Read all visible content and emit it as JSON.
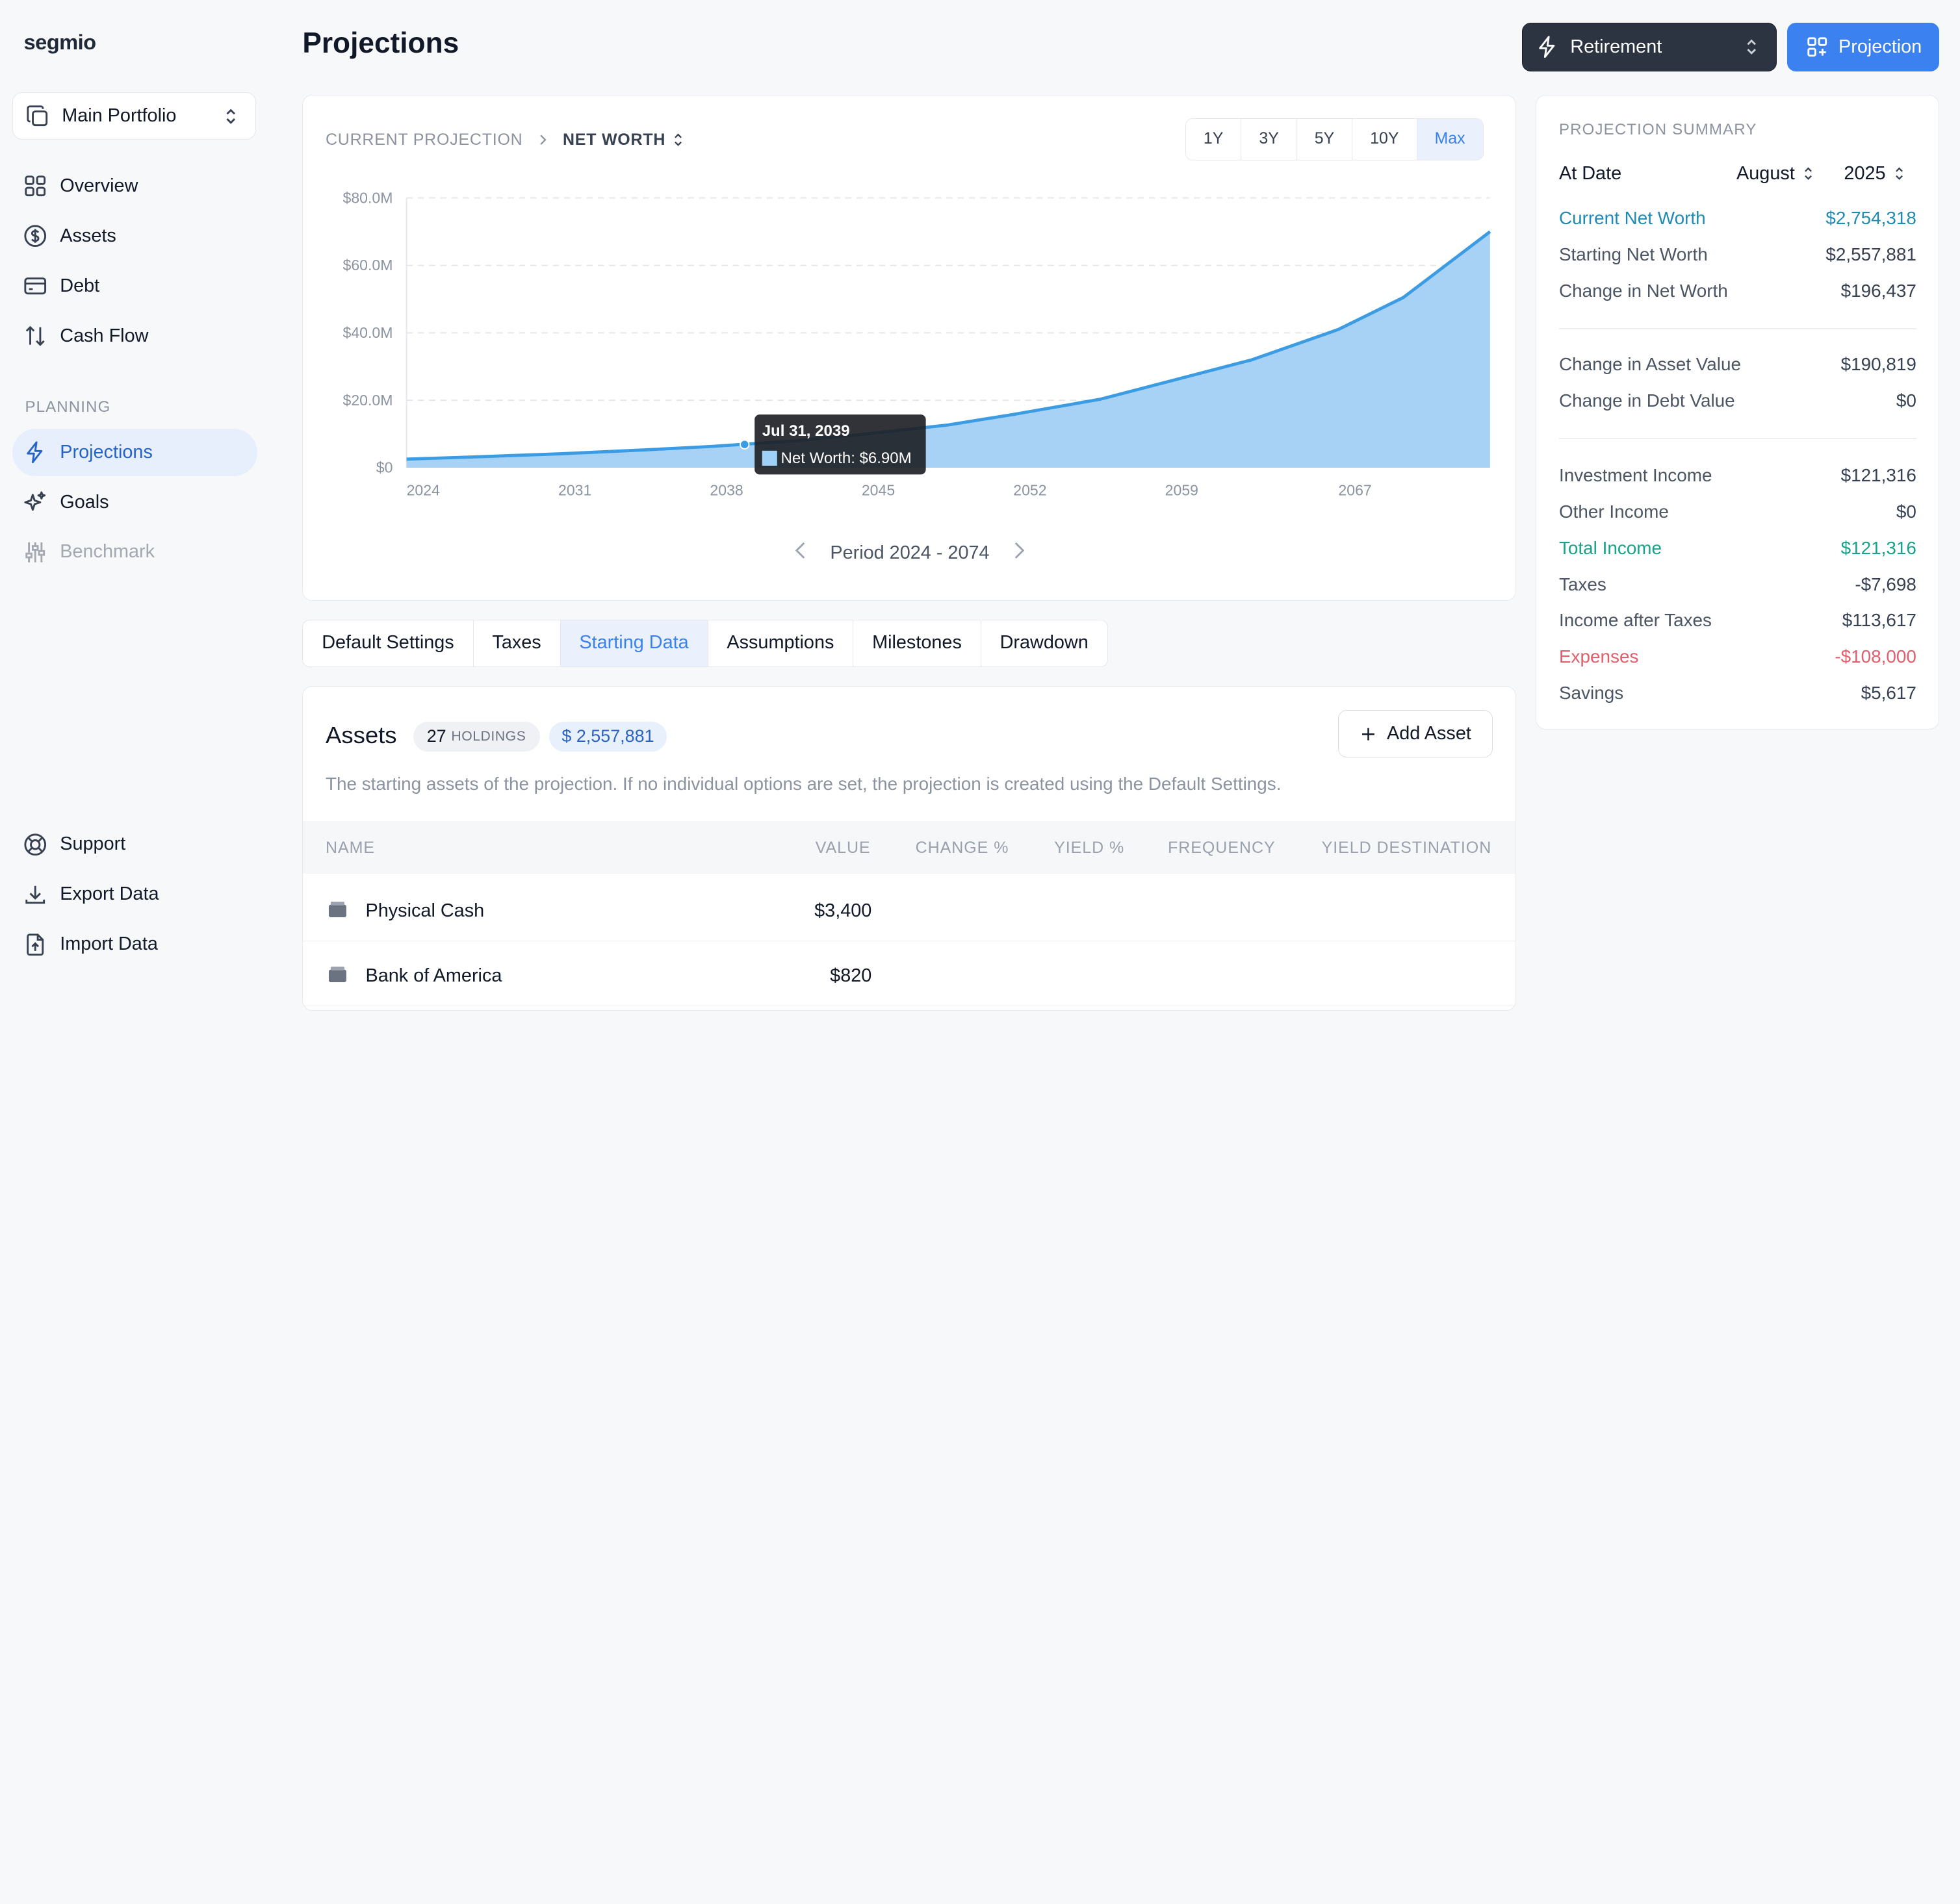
{
  "app": {
    "logo": "segmio"
  },
  "sidebar": {
    "portfolio": "Main Portfolio",
    "items": [
      {
        "label": "Overview",
        "icon": "grid-icon"
      },
      {
        "label": "Assets",
        "icon": "dollar-circle-icon"
      },
      {
        "label": "Debt",
        "icon": "credit-card-icon"
      },
      {
        "label": "Cash Flow",
        "icon": "arrows-up-down-icon"
      }
    ],
    "planning_label": "PLANNING",
    "planning_items": [
      {
        "label": "Projections",
        "icon": "bolt-icon"
      },
      {
        "label": "Goals",
        "icon": "sparkles-icon"
      },
      {
        "label": "Benchmark",
        "icon": "sliders-icon"
      }
    ],
    "footer_items": [
      {
        "label": "Support",
        "icon": "lifebuoy-icon"
      },
      {
        "label": "Export Data",
        "icon": "download-icon"
      },
      {
        "label": "Import Data",
        "icon": "file-upload-icon"
      }
    ]
  },
  "header": {
    "title": "Projections",
    "scenario": "Retirement",
    "projection_button": "Projection"
  },
  "chart_card": {
    "breadcrumb_parent": "CURRENT PROJECTION",
    "breadcrumb_current": "NET WORTH",
    "ranges": [
      "1Y",
      "3Y",
      "5Y",
      "10Y",
      "Max"
    ],
    "active_range": "Max",
    "period_label": "Period 2024 - 2074",
    "tooltip": {
      "date": "Jul 31, 2039",
      "label": "Net Worth: $6.90M"
    }
  },
  "chart_data": {
    "type": "area",
    "series": [
      {
        "name": "Net Worth",
        "x": [
          2024,
          2027,
          2031,
          2035,
          2038,
          2042,
          2045,
          2049,
          2052,
          2056,
          2059,
          2063,
          2067,
          2070,
          2074
        ],
        "values": [
          2.55,
          3.2,
          4.1,
          5.3,
          6.3,
          8.0,
          9.9,
          12.7,
          15.8,
          20.3,
          25.3,
          32.0,
          41.0,
          50.5,
          70.0
        ]
      }
    ],
    "ylabel_ticks": [
      "$0",
      "$20.0M",
      "$40.0M",
      "$60.0M",
      "$80.0M"
    ],
    "xlabel_ticks": [
      "2024",
      "2031",
      "2038",
      "2045",
      "2052",
      "2059",
      "2067"
    ],
    "ylim": [
      0,
      80
    ],
    "xlim": [
      2024,
      2074
    ],
    "grid": true,
    "colors": {
      "line": "#3b9be3",
      "fill": "#a3cff5"
    }
  },
  "tabs": [
    "Default Settings",
    "Taxes",
    "Starting Data",
    "Assumptions",
    "Milestones",
    "Drawdown"
  ],
  "active_tab": "Starting Data",
  "assets": {
    "title": "Assets",
    "holdings_count": "27",
    "holdings_label": "HOLDINGS",
    "total": "$ 2,557,881",
    "add_button": "Add Asset",
    "description": "The starting assets of the projection. If no individual options are set, the projection is created using the Default Settings.",
    "columns": [
      "NAME",
      "VALUE",
      "CHANGE %",
      "YIELD %",
      "FREQUENCY",
      "YIELD DESTINATION"
    ],
    "rows": [
      {
        "name": "Physical Cash",
        "value": "$3,400"
      },
      {
        "name": "Bank of America",
        "value": "$820"
      }
    ]
  },
  "summary": {
    "title": "PROJECTION SUMMARY",
    "at_date_label": "At Date",
    "month": "August",
    "year": "2025",
    "group1": [
      {
        "label": "Current Net Worth",
        "value": "$2,754,318",
        "tone": "teal"
      },
      {
        "label": "Starting Net Worth",
        "value": "$2,557,881",
        "tone": ""
      },
      {
        "label": "Change in Net Worth",
        "value": "$196,437",
        "tone": ""
      }
    ],
    "group2": [
      {
        "label": "Change in Asset Value",
        "value": "$190,819",
        "tone": ""
      },
      {
        "label": "Change in Debt Value",
        "value": "$0",
        "tone": ""
      }
    ],
    "group3": [
      {
        "label": "Investment Income",
        "value": "$121,316",
        "tone": ""
      },
      {
        "label": "Other Income",
        "value": "$0",
        "tone": ""
      },
      {
        "label": "Total Income",
        "value": "$121,316",
        "tone": "green"
      },
      {
        "label": "Taxes",
        "value": "-$7,698",
        "tone": ""
      },
      {
        "label": "Income after Taxes",
        "value": "$113,617",
        "tone": ""
      },
      {
        "label": "Expenses",
        "value": "-$108,000",
        "tone": "red"
      },
      {
        "label": "Savings",
        "value": "$5,617",
        "tone": ""
      }
    ]
  }
}
